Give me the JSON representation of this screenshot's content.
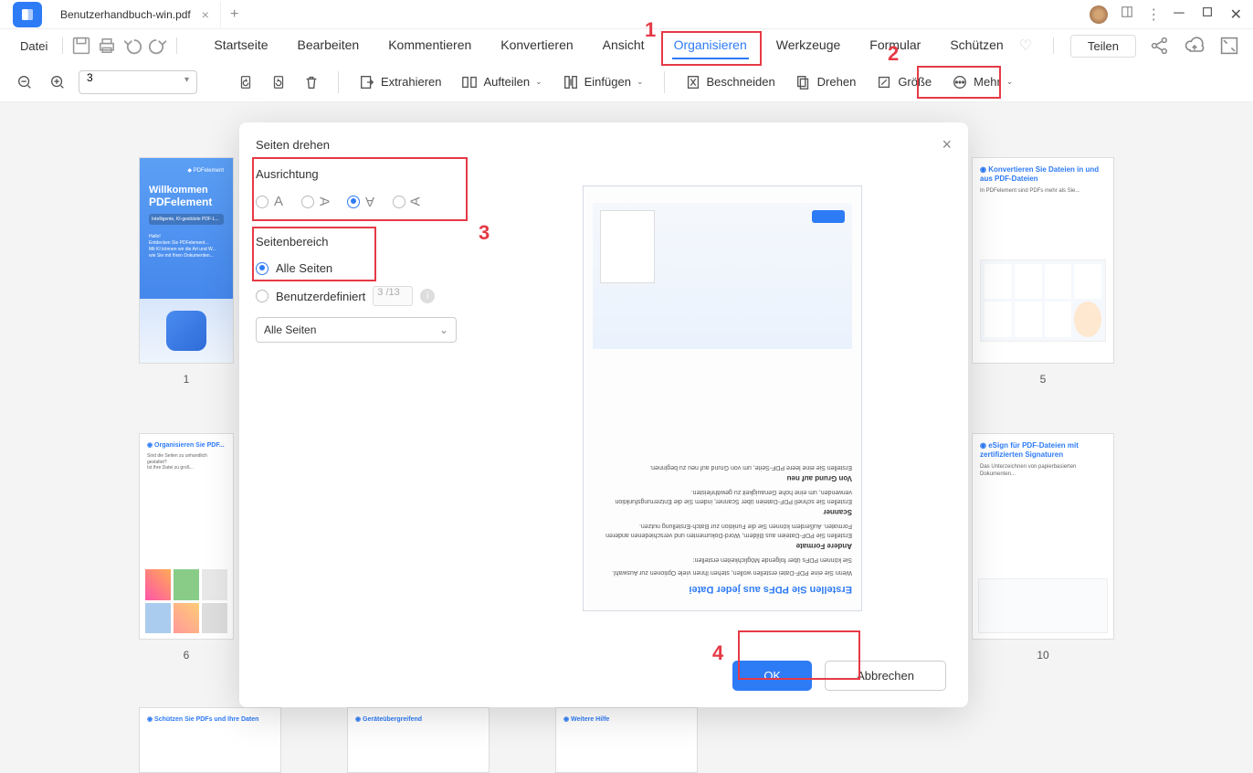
{
  "titlebar": {
    "tab_name": "Benutzerhandbuch-win.pdf"
  },
  "menubar": {
    "file": "Datei",
    "tabs": [
      "Startseite",
      "Bearbeiten",
      "Kommentieren",
      "Konvertieren",
      "Ansicht",
      "Organisieren",
      "Werkzeuge",
      "Formular",
      "Schützen"
    ],
    "active_tab": "Organisieren",
    "share": "Teilen"
  },
  "toolbar": {
    "page_value": "3",
    "extract": "Extrahieren",
    "split": "Aufteilen",
    "insert": "Einfügen",
    "crop": "Beschneiden",
    "rotate": "Drehen",
    "size": "Größe",
    "more": "Mehr"
  },
  "thumbs": {
    "p1": {
      "label": "1",
      "title": "Willkommen",
      "subtitle": "PDFelement"
    },
    "p5": {
      "label": "5"
    },
    "p6": {
      "label": "6"
    },
    "p10": {
      "label": "10"
    }
  },
  "dialog": {
    "title": "Seiten drehen",
    "orientation_label": "Ausrichtung",
    "range_label": "Seitenbereich",
    "all_pages": "Alle Seiten",
    "custom": "Benutzerdefiniert",
    "custom_value": "3 /13",
    "select_value": "Alle Seiten",
    "ok": "OK",
    "cancel": "Abbrechen",
    "preview": {
      "main_title": "Erstellen Sie PDFs aus jeder Datei",
      "line1": "Wenn Sie eine PDF-Datei erstellen wollen, stehen Ihnen viele Optionen zur Auswahl.",
      "line2": "Sie können PDFs über folgende Möglichkeiten erstellen:",
      "h1": "Andere Formate",
      "t1": "Erstellen Sie PDF-Dateien aus Bildern, Word-Dokumenten und verschiedenen anderen Formaten. Außerdem können Sie die Funktion zur Batch-Erstellung nutzen.",
      "h2": "Scanner",
      "t2": "Erstellen Sie schnell PDF-Dateien über Scanner, indem Sie die Entzerrungsfunktion verwenden, um eine hohe Genauigkeit zu gewährleisten.",
      "h3": "Von Grund auf neu",
      "t3": "Erstellen Sie eine leere PDF-Seite, um von Grund auf neu zu beginnen."
    }
  },
  "annotations": {
    "n1": "1",
    "n2": "2",
    "n3": "3",
    "n4": "4"
  }
}
